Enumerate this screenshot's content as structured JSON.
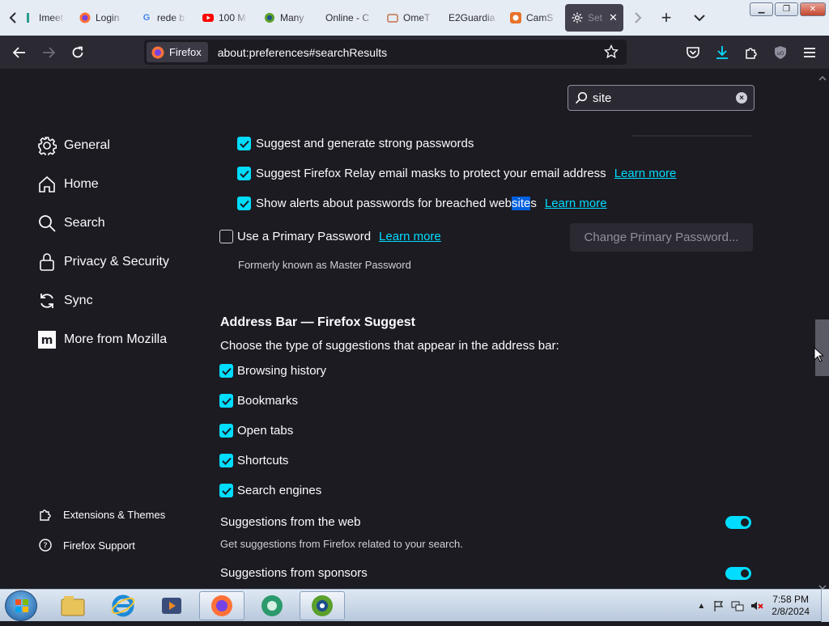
{
  "tabs": [
    {
      "label": "Imeet",
      "icon": "imeet-icon"
    },
    {
      "label": "Login",
      "icon": "firefox-icon"
    },
    {
      "label": "rede b",
      "icon": "google-icon"
    },
    {
      "label": "100 M",
      "icon": "youtube-icon"
    },
    {
      "label": "Many",
      "icon": "manycam-icon"
    },
    {
      "label": "Online - C",
      "icon": "blank-icon"
    },
    {
      "label": "OmeT",
      "icon": "omegle-icon"
    },
    {
      "label": "E2Guardia",
      "icon": "blank-icon"
    },
    {
      "label": "CamS",
      "icon": "camsurf-icon"
    },
    {
      "label": "Set",
      "icon": "gear-icon"
    }
  ],
  "browser": {
    "identity_label": "Firefox",
    "url": "about:preferences#searchResults"
  },
  "search": {
    "value": "site"
  },
  "sidebar": {
    "items": [
      {
        "label": "General",
        "icon": "gear-icon"
      },
      {
        "label": "Home",
        "icon": "home-icon"
      },
      {
        "label": "Search",
        "icon": "search-icon"
      },
      {
        "label": "Privacy & Security",
        "icon": "lock-icon"
      },
      {
        "label": "Sync",
        "icon": "sync-icon"
      },
      {
        "label": "More from Mozilla",
        "icon": "mozilla-icon"
      }
    ],
    "footer": [
      {
        "label": "Extensions & Themes",
        "icon": "puzzle-icon"
      },
      {
        "label": "Firefox Support",
        "icon": "help-icon"
      }
    ]
  },
  "passwords": {
    "suggest_strong": {
      "label": "Suggest and generate strong passwords",
      "checked": true
    },
    "relay_masks": {
      "label": "Suggest Firefox Relay email masks to protect your email address",
      "checked": true,
      "link": "Learn more"
    },
    "breach_alerts": {
      "label_before": "Show alerts about passwords for breached web",
      "label_highlight": "site",
      "label_after": "s",
      "checked": true,
      "link": "Learn more"
    },
    "primary_password": {
      "label": "Use a Primary Password",
      "checked": false,
      "link": "Learn more",
      "button": "Change Primary Password..."
    },
    "formerly": "Formerly known as Master Password"
  },
  "address_bar": {
    "heading": "Address Bar — Firefox Suggest",
    "description": "Choose the type of suggestions that appear in the address bar:",
    "options": [
      {
        "label": "Browsing history",
        "checked": true
      },
      {
        "label": "Bookmarks",
        "checked": true
      },
      {
        "label": "Open tabs",
        "checked": true
      },
      {
        "label": "Shortcuts",
        "checked": true
      },
      {
        "label": "Search engines",
        "checked": true
      }
    ],
    "web_suggestions": {
      "label": "Suggestions from the web",
      "description": "Get suggestions from Firefox related to your search.",
      "enabled": true
    },
    "sponsor_suggestions": {
      "label": "Suggestions from sponsors",
      "enabled": true
    }
  },
  "taskbar": {
    "time": "7:58 PM",
    "date": "2/8/2024"
  },
  "colors": {
    "accent": "#00ddff",
    "page_bg": "#1c1b22",
    "toolbar_bg": "#2b2a33"
  }
}
